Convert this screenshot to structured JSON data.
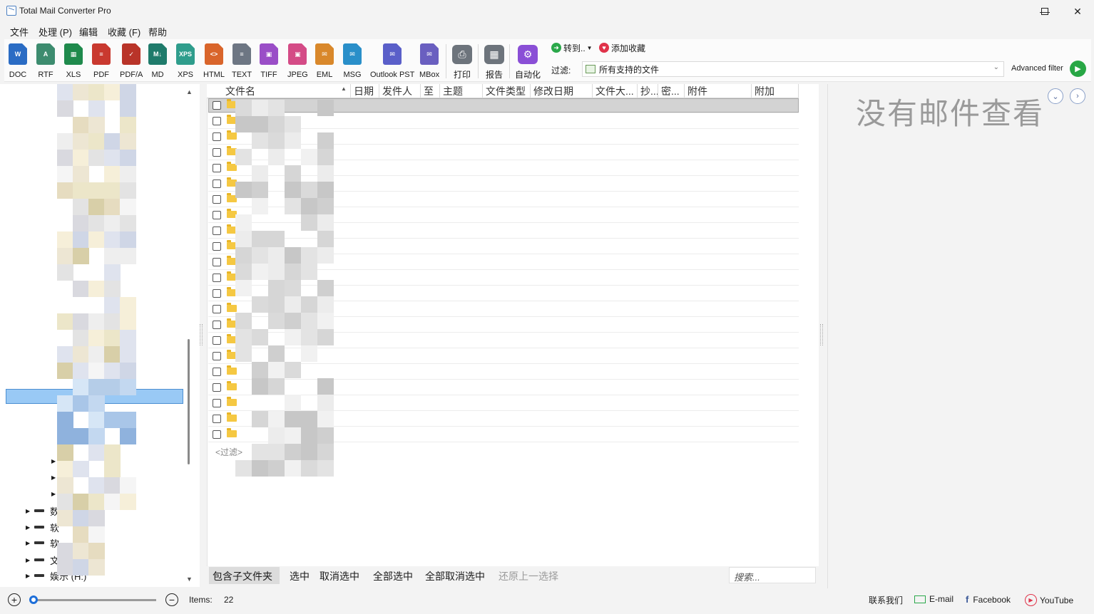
{
  "window": {
    "title": "Total Mail Converter Pro"
  },
  "menu": [
    "文件",
    "处理 (P)",
    "编辑",
    "收藏 (F)",
    "帮助"
  ],
  "toolbar": {
    "formats": [
      {
        "label": "DOC",
        "icon": "doc-icon",
        "color": "#2b6cc4",
        "glyph": "W"
      },
      {
        "label": "RTF",
        "icon": "rtf-icon",
        "color": "#3d8c6f",
        "glyph": "A"
      },
      {
        "label": "XLS",
        "icon": "xls-icon",
        "color": "#1f8a4c",
        "glyph": "▦"
      },
      {
        "label": "PDF",
        "icon": "pdf-icon",
        "color": "#c9392f",
        "glyph": "≡"
      },
      {
        "label": "PDF/A",
        "icon": "pdfa-icon",
        "color": "#b93429",
        "glyph": "✓"
      },
      {
        "label": "MD",
        "icon": "md-icon",
        "color": "#1f7b6b",
        "glyph": "M↓"
      },
      {
        "label": "XPS",
        "icon": "xps-icon",
        "color": "#2f9d8c",
        "glyph": "XPS"
      },
      {
        "label": "HTML",
        "icon": "html-icon",
        "color": "#d9652b",
        "glyph": "<>"
      },
      {
        "label": "TEXT",
        "icon": "text-icon",
        "color": "#6d7683",
        "glyph": "≡"
      },
      {
        "label": "TIFF",
        "icon": "tiff-icon",
        "color": "#9a4ec7",
        "glyph": "▣"
      },
      {
        "label": "JPEG",
        "icon": "jpeg-icon",
        "color": "#d44b86",
        "glyph": "▣"
      },
      {
        "label": "EML",
        "icon": "eml-icon",
        "color": "#d9882b",
        "glyph": "✉"
      },
      {
        "label": "MSG",
        "icon": "msg-icon",
        "color": "#2a8fc9",
        "glyph": "✉"
      },
      {
        "label": "Outlook PST",
        "icon": "pst-icon",
        "color": "#5a5fc9",
        "glyph": "✉"
      },
      {
        "label": "MBox",
        "icon": "mbox-icon",
        "color": "#6a5fc0",
        "glyph": "✉"
      }
    ],
    "print": "打印",
    "report": "报告",
    "automate": "自动化",
    "goto": "转到..",
    "favorite": "添加收藏",
    "filter_label": "过滤:",
    "filter_value": "所有支持的文件",
    "advanced_filter": "Advanced filter"
  },
  "tree": {
    "drives": [
      {
        "label": "数"
      },
      {
        "label": "软"
      },
      {
        "label": "软"
      },
      {
        "label": "文档 (G:)"
      },
      {
        "label": "娱乐 (H:)"
      }
    ]
  },
  "file_list": {
    "columns": [
      "文件名",
      "日期",
      "发件人",
      "至",
      "主题",
      "文件类型",
      "修改日期",
      "文件大...",
      "抄...",
      "密...",
      "附件",
      "附加"
    ],
    "row_count": 22,
    "filter_row": "<过滤>"
  },
  "actions": {
    "include_subfolders": "包含子文件夹",
    "select": "选中",
    "deselect": "取消选中",
    "select_all": "全部选中",
    "deselect_all": "全部取消选中",
    "restore_selection": "还原上一选择",
    "search_placeholder": "搜索..."
  },
  "preview": {
    "empty_text": "没有邮件查看"
  },
  "status": {
    "items_label": "Items:",
    "items_count": "22",
    "contact": "联系我们",
    "email": "E-mail",
    "facebook": "Facebook",
    "youtube": "YouTube"
  },
  "colors": {
    "selection": "#99c9f5",
    "run_button": "#28a745",
    "folder": "#f5c842",
    "zoom_thumb": "#1e6fd9"
  }
}
